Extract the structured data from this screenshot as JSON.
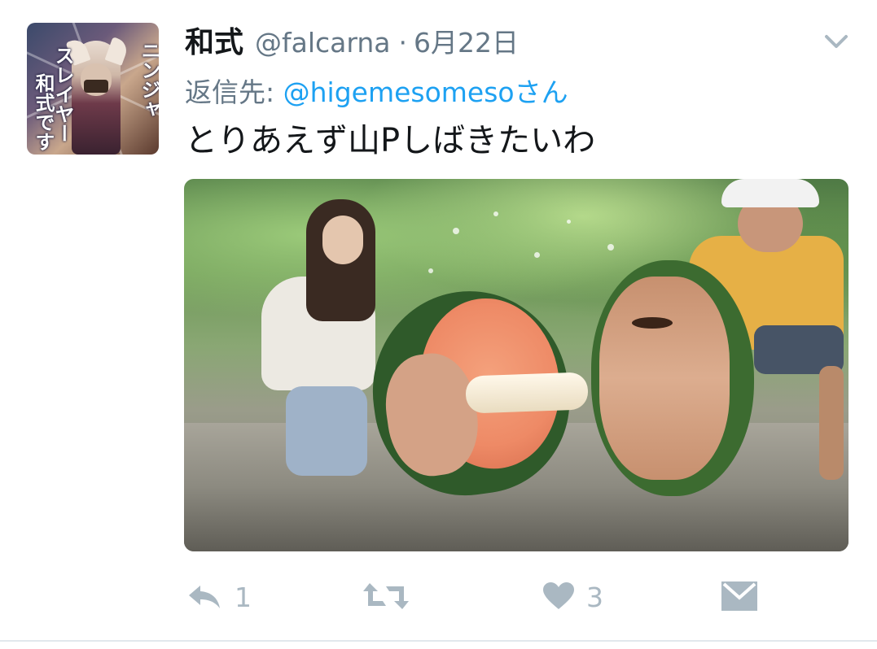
{
  "tweet": {
    "author_name": "和式",
    "author_handle": "@falcarna",
    "separator": "·",
    "date": "6月22日",
    "reply_label": "返信先:",
    "reply_to": "@higemesomesoさん",
    "text": "とりあえず山Pしばきたいわ",
    "avatar_text": {
      "line1": "ニンジャ",
      "line2": "スレイヤー",
      "line3": "和式です"
    },
    "media_description": "photo"
  },
  "actions": {
    "reply_count": "1",
    "retweet_count": "",
    "like_count": "3"
  },
  "colors": {
    "text_primary": "#14171a",
    "text_secondary": "#657786",
    "link": "#1da1f2",
    "action_gray": "#aab8c2",
    "divider": "#e1e8ed"
  },
  "icons": {
    "caret": "chevron-down-icon",
    "reply": "reply-icon",
    "retweet": "retweet-icon",
    "like": "heart-icon",
    "dm": "envelope-icon"
  }
}
